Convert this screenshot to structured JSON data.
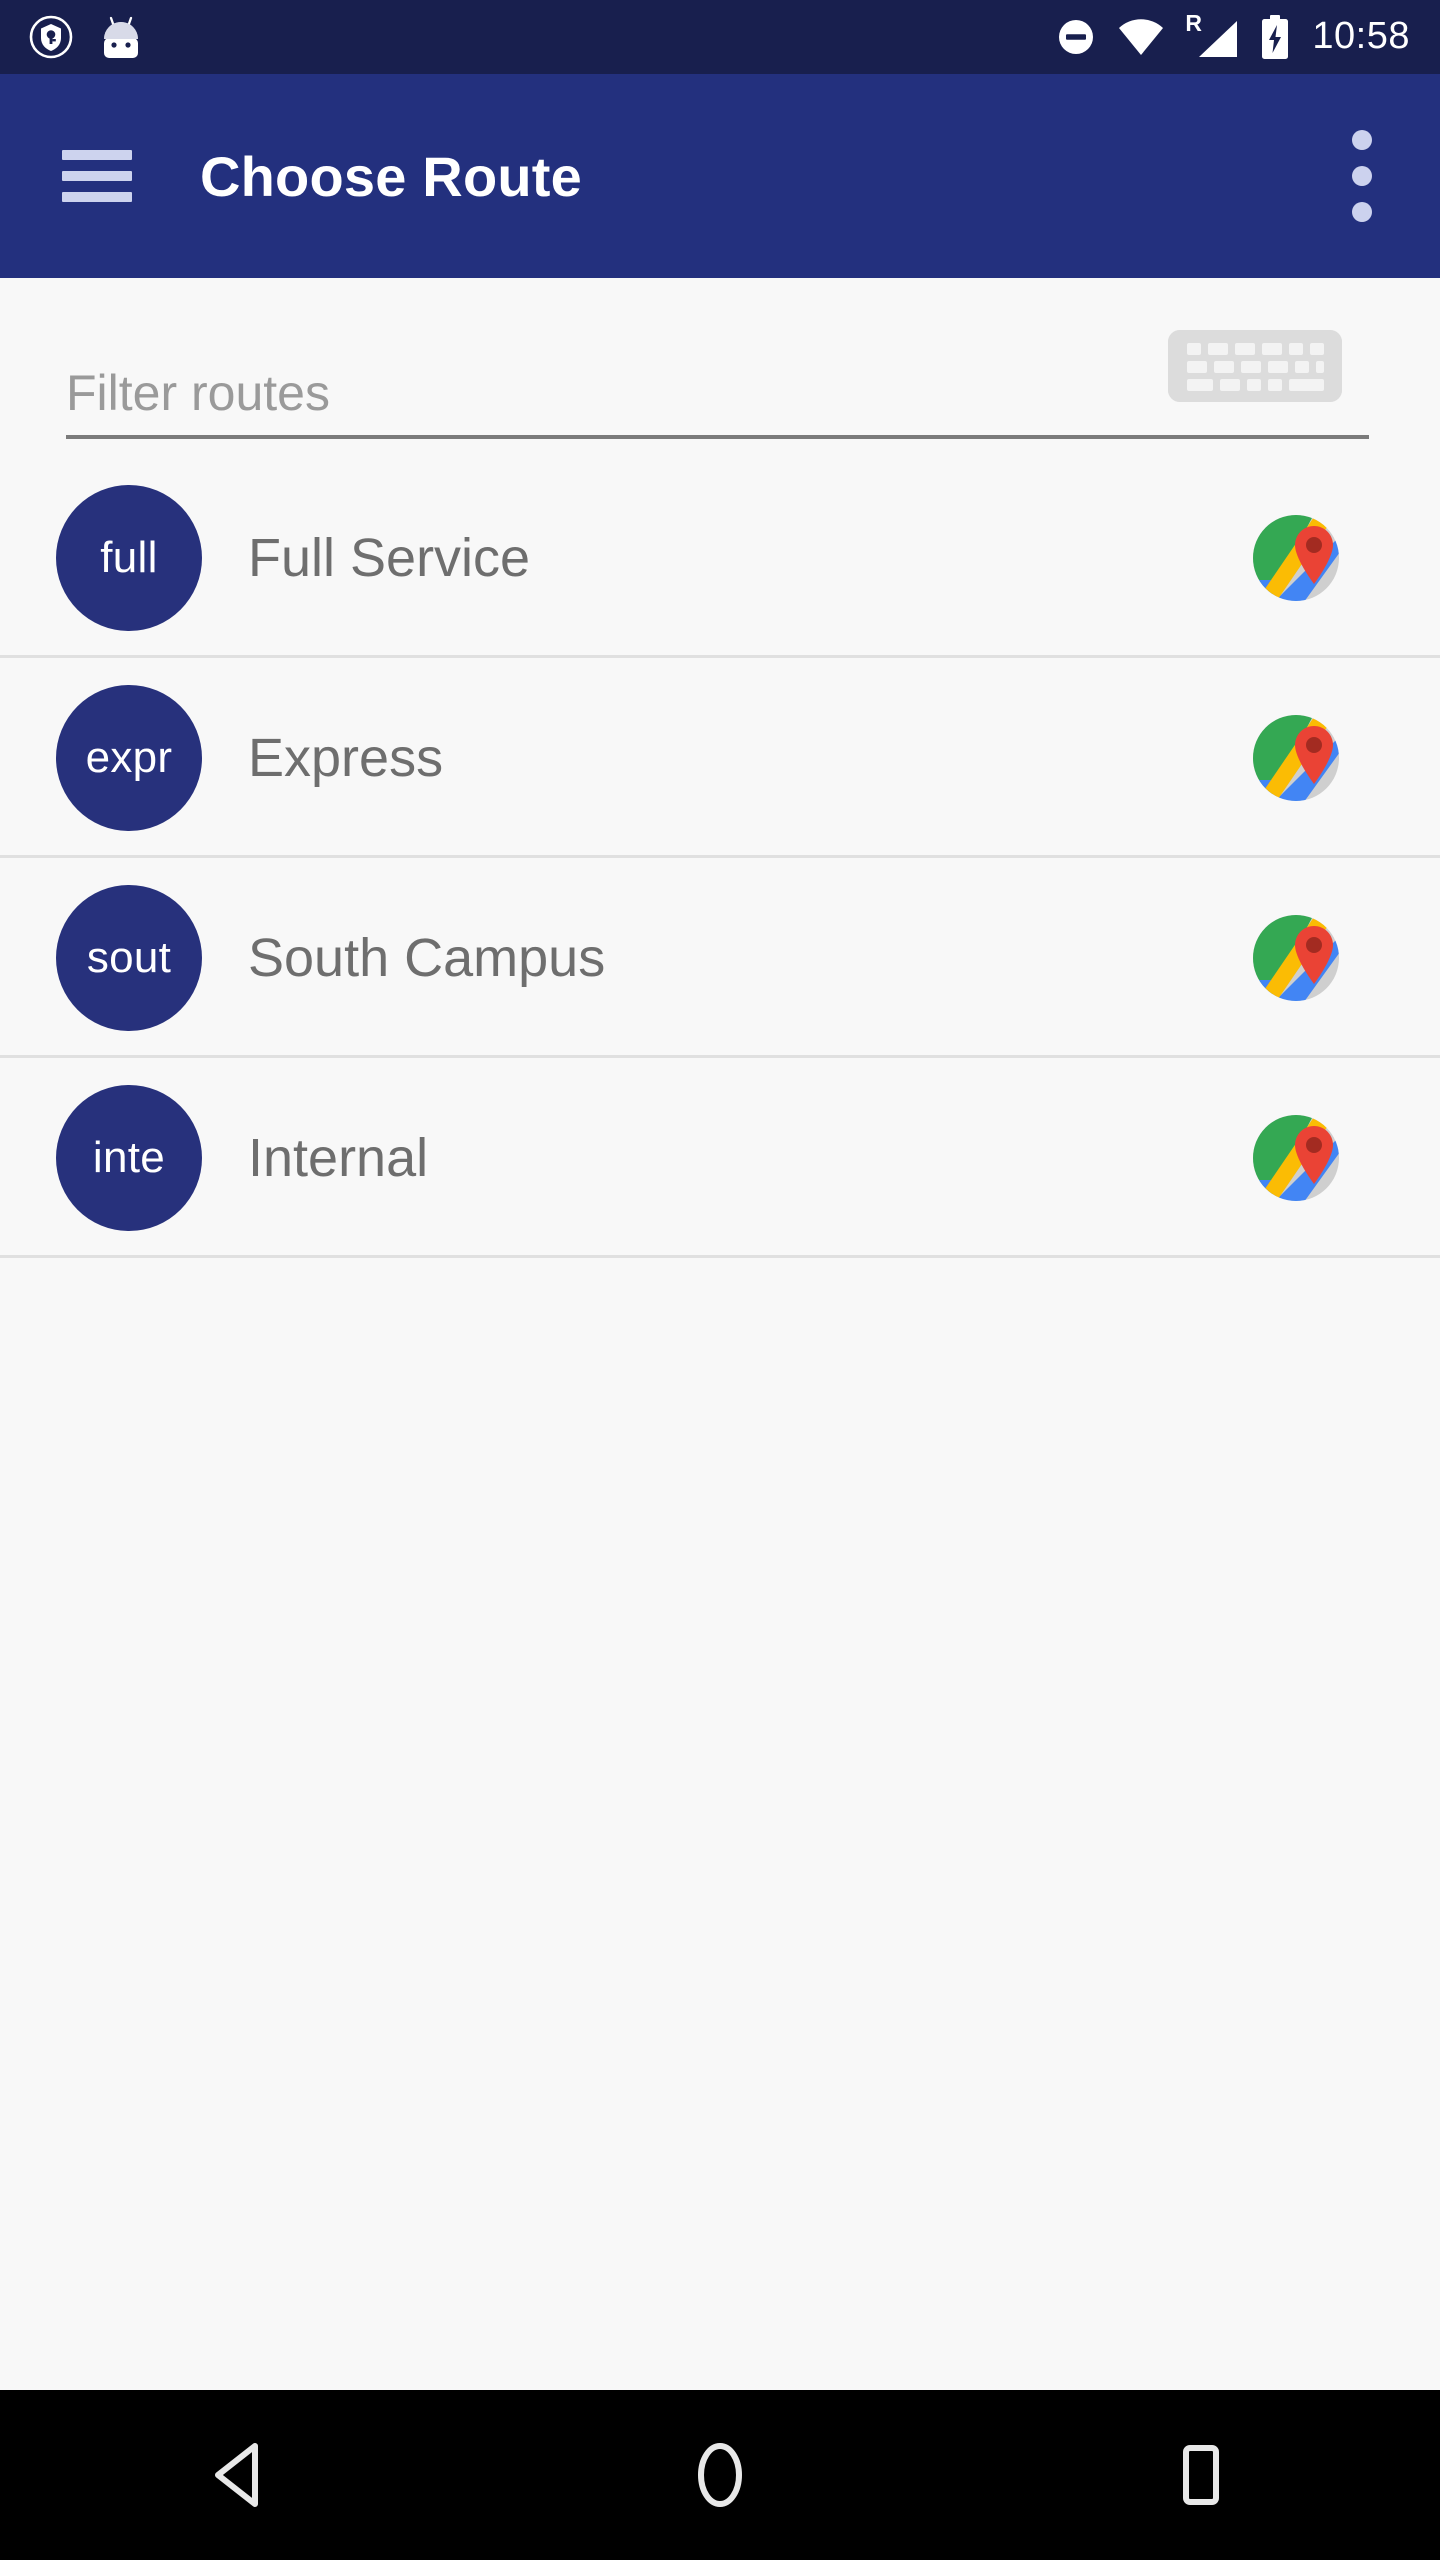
{
  "status_bar": {
    "background_color": "#181f4e",
    "icons": [
      {
        "name": "vpn-key-icon",
        "label": "VPN"
      },
      {
        "name": "android-easter-egg-icon",
        "label": "Android"
      },
      {
        "name": "do-not-disturb-icon",
        "label": "Do Not Disturb"
      },
      {
        "name": "wifi-icon",
        "label": "Wi-Fi"
      },
      {
        "name": "cellular-signal-roaming-icon",
        "label": "Signal Roaming"
      },
      {
        "name": "battery-charging-icon",
        "label": "Battery Charging"
      }
    ],
    "roaming_indicator": "R",
    "clock": "10:58"
  },
  "app_bar": {
    "background_color": "#23307e",
    "title": "Choose Route",
    "menu_icon": "hamburger-menu-icon",
    "overflow_icon": "overflow-menu-icon"
  },
  "filter": {
    "placeholder": "Filter routes",
    "value": "",
    "keyboard_button_icon": "keyboard-icon"
  },
  "routes": [
    {
      "initials": "full",
      "name": "Full Service",
      "map_icon": "google-maps-icon"
    },
    {
      "initials": "expr",
      "name": "Express",
      "map_icon": "google-maps-icon"
    },
    {
      "initials": "sout",
      "name": "South Campus",
      "map_icon": "google-maps-icon"
    },
    {
      "initials": "inte",
      "name": "Internal",
      "map_icon": "google-maps-icon"
    }
  ],
  "nav_bar": {
    "background_color": "#000000",
    "buttons": [
      {
        "name": "back-button",
        "icon": "back-triangle-icon"
      },
      {
        "name": "home-button",
        "icon": "home-circle-icon"
      },
      {
        "name": "recents-button",
        "icon": "recents-square-icon"
      }
    ]
  },
  "colors": {
    "status_bar": "#181f4e",
    "app_bar": "#23307e",
    "avatar": "#27317c",
    "page_background": "#f8f8f8",
    "divider": "#e0e0e0",
    "primary_text": "#6e6e6e",
    "placeholder_text": "#9a9a9a"
  }
}
